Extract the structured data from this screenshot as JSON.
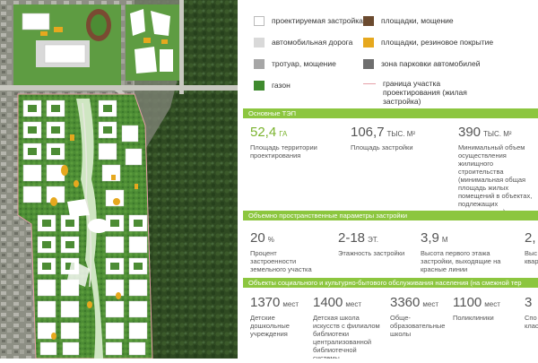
{
  "legend": {
    "items": [
      {
        "label": "проектируемая застройка",
        "swatch": "#ffffff",
        "border": "#bbbbbb",
        "icon": "new-buildings-swatch"
      },
      {
        "label": "автомобильная дорога",
        "swatch": "#d9d9d9",
        "border": "#d9d9d9",
        "icon": "road-swatch"
      },
      {
        "label": "тротуар, мощение",
        "swatch": "#a6a6a6",
        "border": "#a6a6a6",
        "icon": "sidewalk-swatch"
      },
      {
        "label": "газон",
        "swatch": "#3f8a2e",
        "border": "#3f8a2e",
        "icon": "lawn-swatch"
      },
      {
        "label": "площадки, мощение",
        "swatch": "#6b4a2f",
        "border": "#6b4a2f",
        "icon": "paved-area-swatch"
      },
      {
        "label": "площадки, резиновое покрытие",
        "swatch": "#e6a81e",
        "border": "#e6a81e",
        "icon": "rubber-area-swatch"
      },
      {
        "label": "зона парковки автомобилей",
        "swatch": "#6e6e6e",
        "border": "#6e6e6e",
        "icon": "parking-swatch"
      },
      {
        "label": "граница участка проектирования (жилая застройка)",
        "swatch": "#e6a0a8",
        "icon": "boundary-line"
      }
    ]
  },
  "sections": {
    "main": "Основные ТЭП",
    "volume": "Объемно пространственные параметры застройки",
    "social": "Объекты социального и культурно-бытового обслуживания населения (на смежной тер"
  },
  "main_stats": [
    {
      "value": "52,4",
      "unit": "ГА",
      "desc": "Площадь территории проектирования"
    },
    {
      "value": "106,7",
      "unit": "ТЫС. М²",
      "desc": "Площадь застройки"
    },
    {
      "value": "390",
      "unit": "ТЫС. М²",
      "desc": "Минимальный объем осуществления жилищного строительства (минимальная общая площадь жилых помещений в объектах, подлежащих строительству)"
    }
  ],
  "volume_stats": [
    {
      "value": "20",
      "unit": "%",
      "desc": "Процент застроенности земельного участка"
    },
    {
      "value": "2-18",
      "unit": "ЭТ.",
      "desc": "Этажность застройки"
    },
    {
      "value": "3,9",
      "unit": "М",
      "desc": "Высота первого этажа застройки, выходящие на красные линии"
    },
    {
      "value": "2,",
      "unit": "",
      "desc": "Выс кварт"
    }
  ],
  "social_stats": [
    {
      "value": "1370",
      "unit": "мест",
      "desc": "Детские дошкольные учреждения"
    },
    {
      "value": "1400",
      "unit": "мест",
      "desc": "Детская школа искусств с филиалом библиотеки централизованной библиотечной системы"
    },
    {
      "value": "3360",
      "unit": "мест",
      "desc": "Обще-образовательные школы"
    },
    {
      "value": "1100",
      "unit": "мест",
      "desc": "Поликлиники"
    },
    {
      "value": "3",
      "unit": "",
      "desc": "Спо клас"
    }
  ],
  "colors": {
    "accent": "#8cc63f",
    "accent_text": "#7ab32e",
    "forest": "#2f4a22",
    "lawn": "#4c8c34",
    "rubber": "#e6a81e"
  }
}
